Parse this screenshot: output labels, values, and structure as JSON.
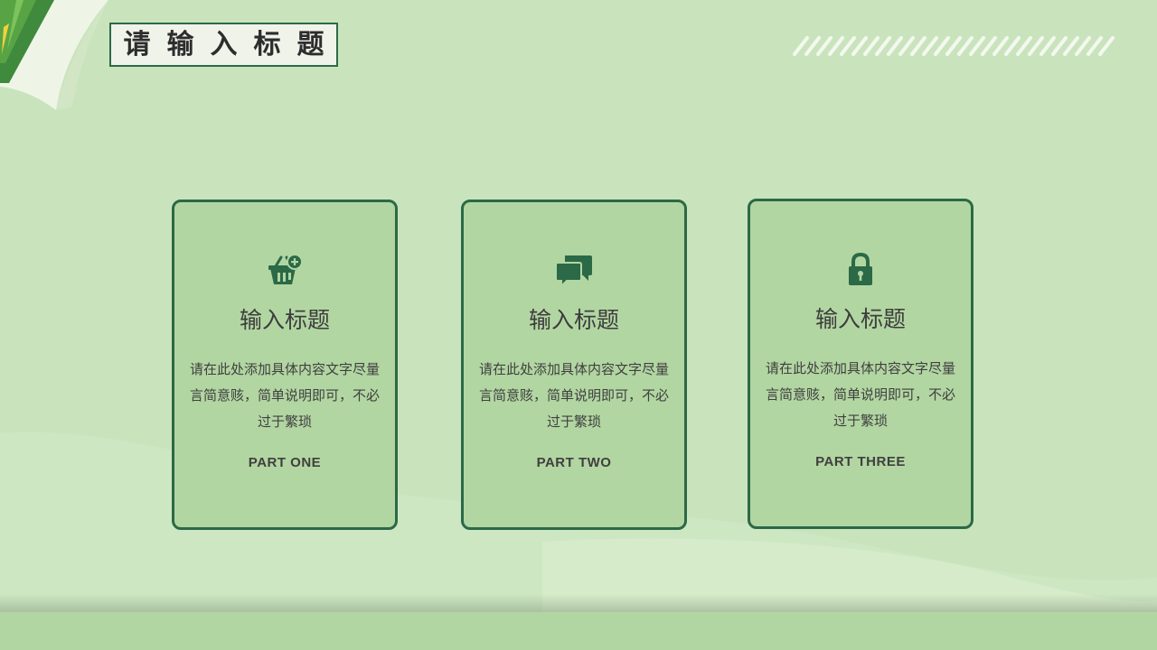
{
  "header": {
    "title": "请输入标题"
  },
  "cards": [
    {
      "icon": "basket-plus-icon",
      "title": "输入标题",
      "body": "请在此处添加具体内容文字尽量言简意赅，简单说明即可，不必过于繁琐",
      "part": "PART ONE"
    },
    {
      "icon": "chat-bubbles-icon",
      "title": "输入标题",
      "body": "请在此处添加具体内容文字尽量言简意赅，简单说明即可，不必过于繁琐",
      "part": "PART TWO"
    },
    {
      "icon": "padlock-icon",
      "title": "输入标题",
      "body": "请在此处添加具体内容文字尽量言简意赅，简单说明即可，不必过于繁琐",
      "part": "PART THREE"
    }
  ],
  "colors": {
    "background": "#c9e4bd",
    "card_fill": "#b2d6a2",
    "accent_dark_green": "#2b6947",
    "text": "#3d3d3d"
  }
}
